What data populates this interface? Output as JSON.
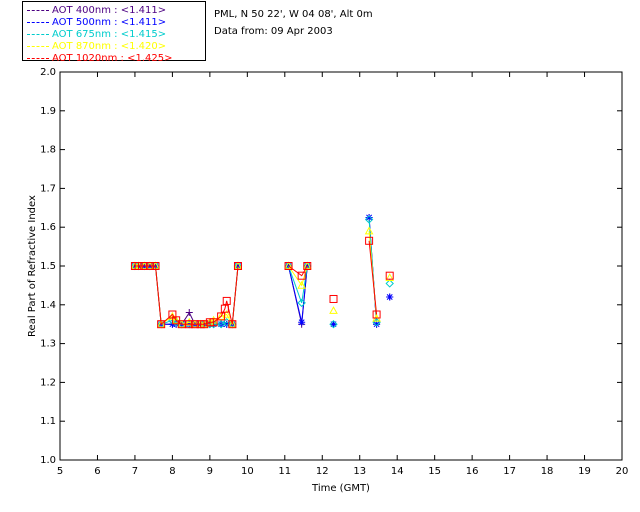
{
  "legend": [
    {
      "label": "AOT  400nm : <1.411>",
      "color": "#4b0082"
    },
    {
      "label": "AOT  500nm : <1.411>",
      "color": "#0000ff"
    },
    {
      "label": "AOT  675nm : <1.415>",
      "color": "#00cccc"
    },
    {
      "label": "AOT  870nm : <1.420>",
      "color": "#ffff00"
    },
    {
      "label": "AOT 1020nm : <1.425>",
      "color": "#ff0000"
    }
  ],
  "info": {
    "site": "PML, N 50 22', W 04 08', Alt 0m",
    "date": "Data from: 09 Apr 2003"
  },
  "chart_data": {
    "type": "line",
    "xlabel": "Time (GMT)",
    "ylabel": "Real Part of Refractive Index",
    "xlim": [
      5,
      20
    ],
    "ylim": [
      1.0,
      2.0
    ],
    "xticks": [
      "5",
      "6",
      "7",
      "8",
      "9",
      "10",
      "11",
      "12",
      "13",
      "14",
      "15",
      "16",
      "17",
      "18",
      "19",
      "20"
    ],
    "yticks": [
      "1.0",
      "1.1",
      "1.2",
      "1.3",
      "1.4",
      "1.5",
      "1.6",
      "1.7",
      "1.8",
      "1.9",
      "2.0"
    ],
    "grid": false,
    "series": [
      {
        "name": "AOT  400nm : <1.411>",
        "color": "#4b0082",
        "marker": "plus",
        "segments": [
          [
            [
              7.0,
              1.5
            ],
            [
              7.1,
              1.5
            ],
            [
              7.25,
              1.5
            ],
            [
              7.4,
              1.5
            ],
            [
              7.55,
              1.5
            ],
            [
              7.7,
              1.35
            ],
            [
              8.0,
              1.35
            ],
            [
              8.1,
              1.35
            ],
            [
              8.25,
              1.35
            ],
            [
              8.45,
              1.38
            ],
            [
              8.6,
              1.35
            ],
            [
              8.75,
              1.35
            ],
            [
              8.85,
              1.35
            ],
            [
              9.0,
              1.35
            ],
            [
              9.1,
              1.35
            ],
            [
              9.3,
              1.35
            ],
            [
              9.45,
              1.35
            ],
            [
              9.6,
              1.35
            ],
            [
              9.75,
              1.5
            ]
          ],
          [
            [
              11.1,
              1.5
            ],
            [
              11.45,
              1.35
            ],
            [
              11.6,
              1.5
            ]
          ],
          [
            [
              12.3,
              1.35
            ]
          ],
          [
            [
              13.25,
              1.625
            ],
            [
              13.45,
              1.35
            ]
          ],
          [
            [
              13.8,
              1.42
            ]
          ]
        ]
      },
      {
        "name": "AOT  500nm : <1.411>",
        "color": "#0000ff",
        "marker": "star",
        "segments": [
          [
            [
              7.0,
              1.5
            ],
            [
              7.1,
              1.5
            ],
            [
              7.25,
              1.5
            ],
            [
              7.4,
              1.5
            ],
            [
              7.55,
              1.5
            ],
            [
              7.7,
              1.35
            ],
            [
              8.0,
              1.35
            ],
            [
              8.1,
              1.35
            ],
            [
              8.25,
              1.35
            ],
            [
              8.45,
              1.35
            ],
            [
              8.6,
              1.35
            ],
            [
              8.75,
              1.35
            ],
            [
              8.85,
              1.35
            ],
            [
              9.0,
              1.35
            ],
            [
              9.1,
              1.35
            ],
            [
              9.3,
              1.35
            ],
            [
              9.45,
              1.35
            ],
            [
              9.6,
              1.35
            ],
            [
              9.75,
              1.5
            ]
          ],
          [
            [
              11.1,
              1.5
            ],
            [
              11.45,
              1.355
            ],
            [
              11.6,
              1.5
            ]
          ],
          [
            [
              12.3,
              1.35
            ]
          ],
          [
            [
              13.25,
              1.625
            ],
            [
              13.45,
              1.35
            ]
          ],
          [
            [
              13.8,
              1.42
            ]
          ]
        ]
      },
      {
        "name": "AOT  675nm : <1.415>",
        "color": "#00cccc",
        "marker": "diamond",
        "segments": [
          [
            [
              7.0,
              1.5
            ],
            [
              7.1,
              1.5
            ],
            [
              7.25,
              1.5
            ],
            [
              7.4,
              1.5
            ],
            [
              7.55,
              1.5
            ],
            [
              7.7,
              1.35
            ],
            [
              8.0,
              1.36
            ],
            [
              8.1,
              1.355
            ],
            [
              8.25,
              1.35
            ],
            [
              8.45,
              1.35
            ],
            [
              8.6,
              1.35
            ],
            [
              8.75,
              1.35
            ],
            [
              8.85,
              1.35
            ],
            [
              9.0,
              1.35
            ],
            [
              9.1,
              1.35
            ],
            [
              9.3,
              1.35
            ],
            [
              9.45,
              1.355
            ],
            [
              9.6,
              1.35
            ],
            [
              9.75,
              1.5
            ]
          ],
          [
            [
              11.1,
              1.5
            ],
            [
              11.45,
              1.405
            ],
            [
              11.6,
              1.5
            ]
          ],
          [
            [
              12.3,
              1.35
            ]
          ],
          [
            [
              13.25,
              1.62
            ],
            [
              13.45,
              1.355
            ]
          ],
          [
            [
              13.8,
              1.455
            ]
          ]
        ]
      },
      {
        "name": "AOT  870nm : <1.420>",
        "color": "#ffff00",
        "marker": "triangle",
        "segments": [
          [
            [
              7.0,
              1.5
            ],
            [
              7.1,
              1.5
            ],
            [
              7.25,
              1.5
            ],
            [
              7.4,
              1.5
            ],
            [
              7.55,
              1.5
            ],
            [
              7.7,
              1.35
            ],
            [
              8.0,
              1.37
            ],
            [
              8.1,
              1.36
            ],
            [
              8.25,
              1.35
            ],
            [
              8.45,
              1.355
            ],
            [
              8.6,
              1.35
            ],
            [
              8.75,
              1.35
            ],
            [
              8.85,
              1.35
            ],
            [
              9.0,
              1.355
            ],
            [
              9.1,
              1.36
            ],
            [
              9.3,
              1.37
            ],
            [
              9.45,
              1.375
            ],
            [
              9.6,
              1.35
            ],
            [
              9.75,
              1.5
            ]
          ],
          [
            [
              11.1,
              1.5
            ],
            [
              11.45,
              1.45
            ],
            [
              11.6,
              1.5
            ]
          ],
          [
            [
              12.3,
              1.385
            ]
          ],
          [
            [
              13.25,
              1.59
            ],
            [
              13.45,
              1.365
            ]
          ],
          [
            [
              13.8,
              1.47
            ]
          ]
        ]
      },
      {
        "name": "AOT 1020nm : <1.425>",
        "color": "#ff0000",
        "marker": "square",
        "segments": [
          [
            [
              7.0,
              1.5
            ],
            [
              7.1,
              1.5
            ],
            [
              7.25,
              1.5
            ],
            [
              7.4,
              1.5
            ],
            [
              7.55,
              1.5
            ],
            [
              7.7,
              1.35
            ],
            [
              8.0,
              1.375
            ],
            [
              8.1,
              1.36
            ],
            [
              8.25,
              1.35
            ],
            [
              8.45,
              1.35
            ],
            [
              8.6,
              1.35
            ],
            [
              8.75,
              1.35
            ],
            [
              8.85,
              1.35
            ],
            [
              9.0,
              1.355
            ],
            [
              9.1,
              1.355
            ],
            [
              9.3,
              1.37
            ],
            [
              9.4,
              1.39
            ],
            [
              9.45,
              1.41
            ],
            [
              9.6,
              1.35
            ],
            [
              9.75,
              1.5
            ]
          ],
          [
            [
              11.1,
              1.5
            ],
            [
              11.45,
              1.475
            ],
            [
              11.6,
              1.5
            ]
          ],
          [
            [
              12.3,
              1.415
            ]
          ],
          [
            [
              13.25,
              1.565
            ],
            [
              13.45,
              1.375
            ]
          ],
          [
            [
              13.8,
              1.475
            ]
          ]
        ]
      }
    ]
  }
}
